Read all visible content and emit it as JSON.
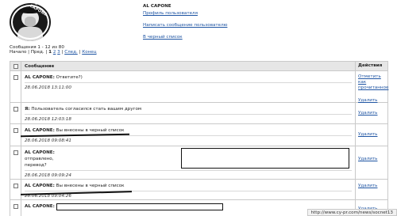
{
  "profile": {
    "logo_text": "AL CAPONE",
    "name": "AL CAPONE",
    "link_profile": "Профиль пользователя",
    "link_write": "Написать сообщение пользователю",
    "link_blacklist": "В черный список"
  },
  "summary": "Сообщения 1 - 12 из 80",
  "pager": {
    "start": "Начало",
    "prev": "Пред.",
    "page1": "1",
    "page2": "2",
    "page3": "3",
    "next": "След.",
    "end": "Конец"
  },
  "table": {
    "col_message": "Сообщение",
    "col_actions": "Действия"
  },
  "messages": [
    {
      "sender": "AL CAPONE:",
      "text": "Ответите?)",
      "date": "28.06.2018 13:11:00",
      "action1": "Отметить как прочитанное",
      "action2": "Удалить"
    },
    {
      "sender": "Я:",
      "text": "Пользователь согласился стать вашим другом",
      "date": "28.06.2018 12:03:18",
      "action1": "Удалить"
    },
    {
      "sender": "AL CAPONE:",
      "text": "Вы внесены в черный список",
      "date": "28.06.2018 09:08:41",
      "action1": "Удалить"
    },
    {
      "sender": "AL CAPONE:",
      "line2": "отправлено,",
      "line3": "перевод?",
      "date": "28.06.2018 09:09:24",
      "action1": "Удалить"
    },
    {
      "sender": "AL CAPONE:",
      "text": "Вы внесены в черный список",
      "date": "28.06.2018 09:04:26",
      "action1": "Удалить"
    },
    {
      "sender": "AL CAPONE:",
      "action1": "Удалить"
    }
  ],
  "status_url": "http://www.cy-pr.com/news/socnet13"
}
